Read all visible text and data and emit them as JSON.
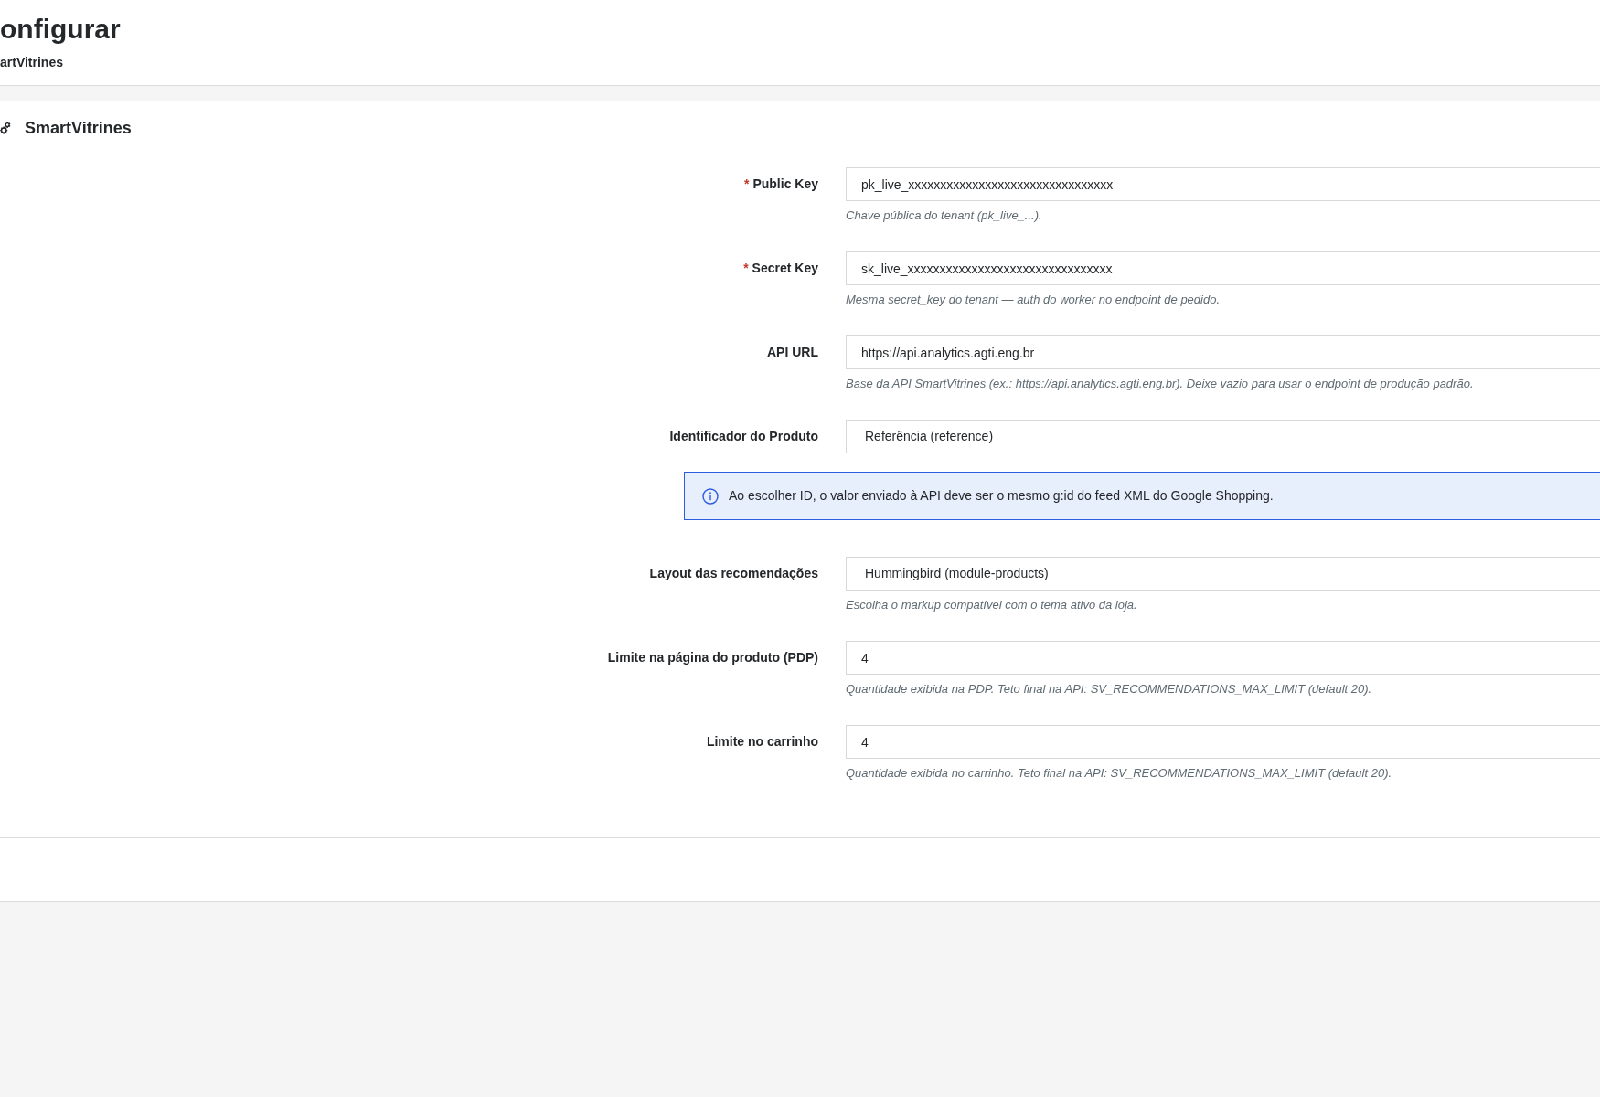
{
  "page_header": {
    "title": "onfigurar",
    "subtitle": "artVitrines"
  },
  "panel": {
    "title": "SmartVitrines"
  },
  "required_mark": "*",
  "fields": [
    {
      "kind": "text",
      "label": "Public Key",
      "required": true,
      "value": "pk_live_xxxxxxxxxxxxxxxxxxxxxxxxxxxxxxxx",
      "help": "Chave pública do tenant (pk_live_...)."
    },
    {
      "kind": "text",
      "label": "Secret Key",
      "required": true,
      "value": "sk_live_xxxxxxxxxxxxxxxxxxxxxxxxxxxxxxxx",
      "help": "Mesma secret_key do tenant — auth do worker no endpoint de pedido."
    },
    {
      "kind": "text",
      "label": "API URL",
      "required": false,
      "value": "https://api.analytics.agti.eng.br",
      "help": "Base da API SmartVitrines (ex.: https://api.analytics.agti.eng.br). Deixe vazio para usar o endpoint de produção padrão."
    },
    {
      "kind": "select",
      "label": "Identificador do Produto",
      "required": false,
      "value": "Referência (reference)",
      "notice": "Ao escolher ID, o valor enviado à API deve ser o mesmo g:id do feed XML do Google Shopping."
    },
    {
      "kind": "select",
      "label": "Layout das recomendações",
      "required": false,
      "value": "Hummingbird (module-products)",
      "help": "Escolha o markup compatível com o tema ativo da loja."
    },
    {
      "kind": "text",
      "label": "Limite na página do produto (PDP)",
      "required": false,
      "value": "4",
      "help": "Quantidade exibida na PDP. Teto final na API: SV_RECOMMENDATIONS_MAX_LIMIT (default 20)."
    },
    {
      "kind": "text",
      "label": "Limite no carrinho",
      "required": false,
      "value": "4",
      "help": "Quantidade exibida no carrinho. Teto final na API: SV_RECOMMENDATIONS_MAX_LIMIT (default 20)."
    }
  ]
}
